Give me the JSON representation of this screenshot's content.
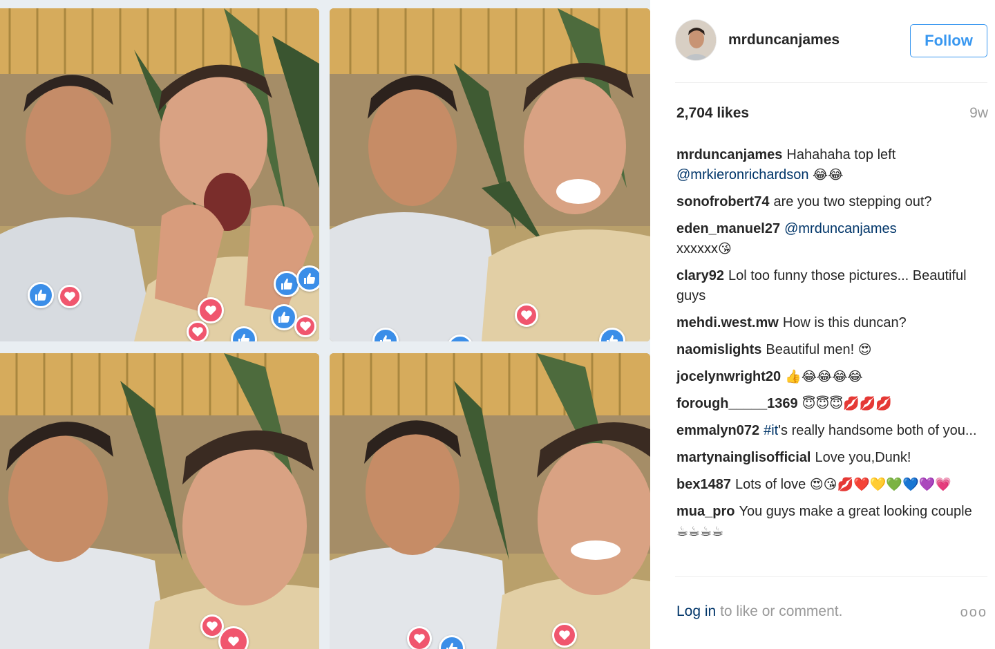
{
  "post": {
    "username": "mrduncanjames",
    "follow_label": "Follow",
    "likes": "2,704 likes",
    "time_ago": "9w"
  },
  "comments": [
    {
      "user": "mrduncanjames",
      "text": "Hahahaha top left",
      "mention": "@mrkieronrichardson",
      "emoji": "😂😂"
    },
    {
      "user": "sonofrobert74",
      "text": "are you two stepping out?"
    },
    {
      "user": "eden_manuel27",
      "mention": "@mrduncanjames",
      "text": "xxxxxx",
      "emoji": "😘"
    },
    {
      "user": "clary92",
      "text": "Lol too funny those pictures... Beautiful guys"
    },
    {
      "user": "mehdi.west.mw",
      "text": "How is this duncan?"
    },
    {
      "user": "naomislights",
      "text": "Beautiful men!",
      "emoji": "😍"
    },
    {
      "user": "jocelynwright20",
      "emoji": "👍😂😂😂😂"
    },
    {
      "user": "forough_____1369",
      "emoji": "😇😇😇💋💋💋"
    },
    {
      "user": "emmalyn072",
      "hashtag": "#it",
      "text": "'s really handsome both of you..."
    },
    {
      "user": "martynainglisofficial",
      "text": "Love you,Dunk!"
    },
    {
      "user": "bex1487",
      "text": "Lots of love",
      "emoji": "😍😘💋❤️💛💚💙💜💗"
    },
    {
      "user": "mua_pro",
      "text": "You guys make a great looking couple",
      "emoji": "☕☕☕☕"
    }
  ],
  "footer": {
    "login_label": "Log in",
    "login_suffix": "to like or comment.",
    "more_label": "ooo"
  },
  "icons": {
    "like_reaction": "thumbs-up-icon",
    "heart_reaction": "heart-icon",
    "more": "more-options-icon"
  },
  "colors": {
    "accent": "#3897f0",
    "link": "#003569",
    "muted": "#999999",
    "like_bubble": "#3b8ee8",
    "heart_bubble": "#f0566e"
  }
}
